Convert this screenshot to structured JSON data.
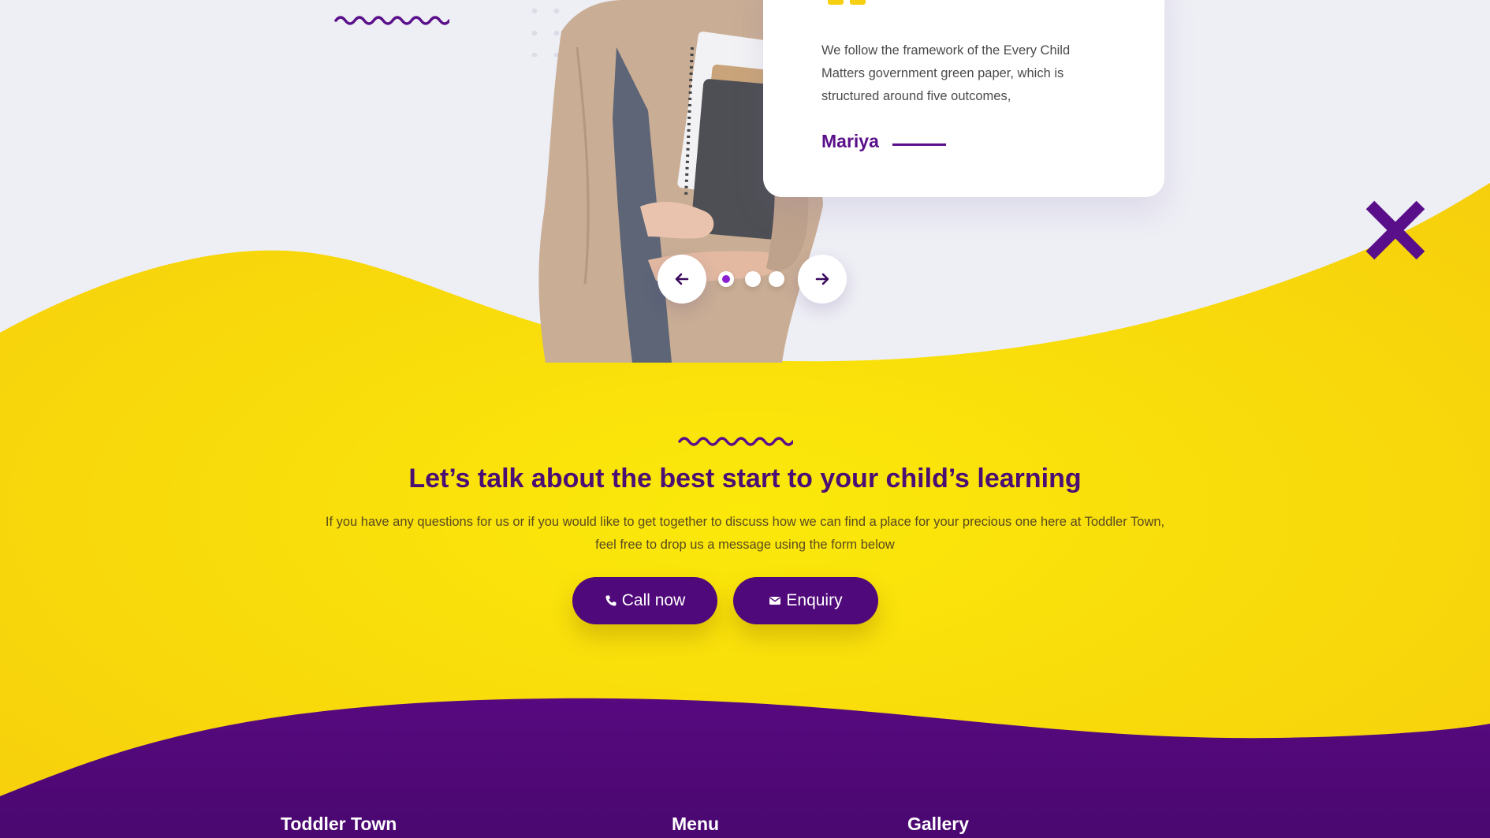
{
  "testimonial": {
    "text": "We follow the framework of the Every Child Matters government green paper, which is structured around five outcomes,",
    "author": "Mariya"
  },
  "carousel": {
    "prev_icon": "arrow-left-icon",
    "next_icon": "arrow-right-icon",
    "slide_count": 3,
    "active_slide": 1
  },
  "cta_section": {
    "headline": "Let’s talk about the best start to your child’s learning",
    "description": "If you have any questions for us or if you would like to get together to discuss how we can find a place for your precious one here at Toddler Town, feel free to drop us a message using the form below",
    "call_label": "Call now",
    "call_icon": "phone-icon",
    "enquiry_label": "Enquiry",
    "enquiry_icon": "envelope-icon"
  },
  "footer": {
    "col1_title": "Toddler Town",
    "col2_title": "Menu",
    "col3_title": "Gallery"
  },
  "colors": {
    "brand_purple": "#50097a",
    "accent_yellow": "#f7dc0a",
    "background": "#eeeef5"
  }
}
